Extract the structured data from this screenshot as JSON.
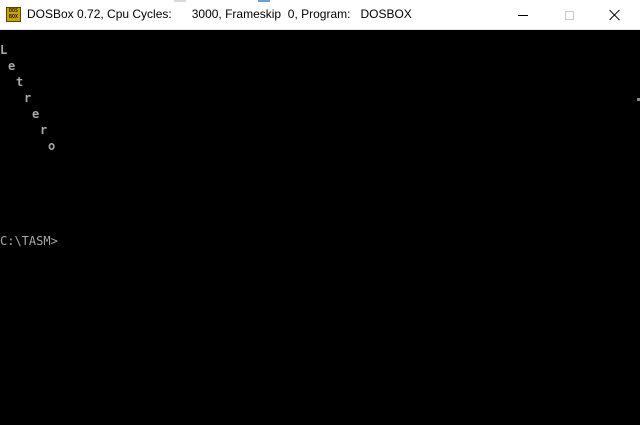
{
  "window": {
    "icon_text_top": "DOS",
    "icon_text_bottom": "BOX",
    "title": "DOSBox 0.72, Cpu Cycles:      3000, Frameskip  0, Program:   DOSBOX"
  },
  "controls": {
    "minimize": "minimize-icon",
    "maximize": "maximize-icon",
    "close": "close-icon"
  },
  "screen": {
    "letters": [
      "L",
      "e",
      "t",
      "r",
      "e",
      "r",
      "o"
    ],
    "prompt": "C:\\TASM>"
  },
  "colors": {
    "dos_text": "#a8a8a8",
    "background": "#000000",
    "titlebar": "#ffffff"
  }
}
